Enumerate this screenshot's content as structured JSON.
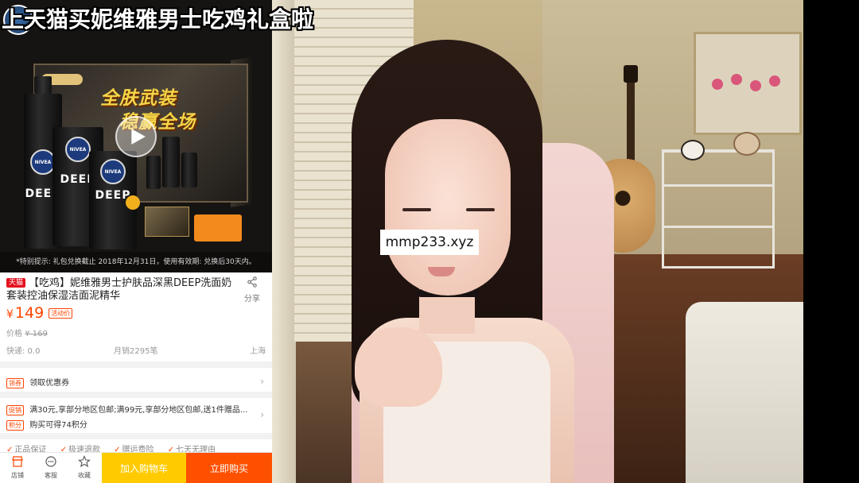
{
  "overlay": {
    "title": "上天猫买妮维雅男士吃鸡礼盒啦"
  },
  "product_image": {
    "promo_line_1": "全肤武装",
    "promo_line_2": "稳赢全场",
    "brand": "NIVEA MEN",
    "product_line": "DEEP",
    "footnote": "*特别提示: 礼包兑换截止 2018年12月31日，使用有效期: 兑换后30天内。"
  },
  "product": {
    "store_tag": "天猫",
    "title": "【吃鸡】妮维雅男士护肤品深黑DEEP洗面奶套装控油保湿洁面泥精华",
    "share_label": "分享",
    "currency": "¥",
    "price": "149",
    "price_tag": "活动价",
    "original_price_label": "价格",
    "original_price": "¥ 169",
    "shipping": "快递: 0.0",
    "monthly_sales": "月销2295笔",
    "location": "上海"
  },
  "options": [
    {
      "tag": "领券",
      "text": "领取优惠券"
    },
    {
      "tag": "促销",
      "text": "满30元,享部分地区包邮;满99元,享部分地区包邮,送1件赠品..."
    },
    {
      "tag": "积分",
      "text": "购买可得74积分"
    }
  ],
  "services": [
    "正品保证",
    "极速退款",
    "赠运费险",
    "七天无理由"
  ],
  "bottom_bar": {
    "store_label": "店铺",
    "service_label": "客服",
    "favorite_label": "收藏",
    "add_to_cart": "加入购物车",
    "buy_now": "立即购买"
  },
  "stream": {
    "watermark": "mmp233.xyz"
  }
}
